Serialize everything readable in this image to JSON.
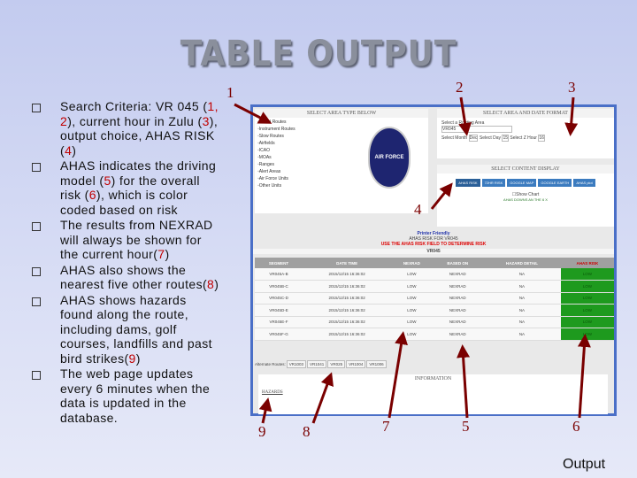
{
  "title": "TABLE OUTPUT",
  "bullets": [
    {
      "parts": [
        "Search Criteria: VR 045 (",
        "1, 2",
        "), current hour in Zulu (",
        "3",
        "), output choice, AHAS RISK (",
        "4",
        ")"
      ]
    },
    {
      "parts": [
        "AHAS indicates the driving model (",
        "5",
        ") for the overall risk (",
        "6",
        "), which is color coded based on risk"
      ]
    },
    {
      "parts": [
        "The results from NEXRAD will always be shown for the current hour(",
        "7",
        ")"
      ]
    },
    {
      "parts": [
        " AHAS also shows the nearest five other routes(",
        "8",
        ")"
      ]
    },
    {
      "parts": [
        "AHAS shows hazards found along the route, including dams, golf courses, landfills and past bird strikes(",
        "9",
        ")"
      ]
    },
    {
      "parts": [
        "The web page updates every 6 minutes when the data is updated in the database."
      ]
    }
  ],
  "screenshot": {
    "area_header": "SELECT AREA TYPE BELOW",
    "area_types": [
      "Visual Routes",
      "Instrument Routes",
      "Slow Routes",
      "Airfields",
      "ICAO",
      "MOAs",
      "Ranges",
      "Alert Areas",
      "Air Force Units",
      "Other Units"
    ],
    "logo_text": [
      "AIR FORCE",
      "SAFETY"
    ],
    "date_header": "SELECT AREA AND DATE FORMAT",
    "select_area_label": "Select a Routing Area",
    "select_area_value": "VR045",
    "month_label": "Select Month",
    "month_value": "Dec",
    "day_label": "Select Day",
    "day_value": "15",
    "hour_label": "Select Z Hour",
    "hour_value": "16",
    "content_header": "SELECT CONTENT DISPLAY",
    "buttons": [
      "AHAS RISK",
      "72HR RISK",
      "GOOGLE MAP",
      "GOOGLE EARTH",
      "AHAS plot"
    ],
    "show_chart": "Show Chart",
    "note": "AHAS DOWNS AN THE 6 X",
    "printer": "Printer Friendly",
    "risk_for": "AHAS RISK FOR VR045",
    "warning": "USE THE AHAS RISK FIELD TO DETERMINE RISK",
    "route": "VR045",
    "columns": [
      "SEGMENT",
      "DATE TIME",
      "NEXRAD",
      "BASED ON",
      "HAZARD DETAIL",
      "AHAS RISK"
    ],
    "rows": [
      [
        "VR045A-B",
        "2015/12/15 16:36:02",
        "LOW",
        "NEXRAD",
        "NA",
        "LOW"
      ],
      [
        "VR045B-C",
        "2015/12/15 16:36:02",
        "LOW",
        "NEXRAD",
        "NA",
        "LOW"
      ],
      [
        "VR045C-D",
        "2015/12/15 16:36:02",
        "LOW",
        "NEXRAD",
        "NA",
        "LOW"
      ],
      [
        "VR045D-E",
        "2015/12/15 16:36:02",
        "LOW",
        "NEXRAD",
        "NA",
        "LOW"
      ],
      [
        "VR045E-F",
        "2015/12/15 16:36:02",
        "LOW",
        "NEXRAD",
        "NA",
        "LOW"
      ],
      [
        "VR045F-G",
        "2015/12/15 16:36:02",
        "LOW",
        "NEXRAD",
        "NA",
        "LOW"
      ]
    ],
    "alt_label": "Alternate Routes:",
    "alt_routes": [
      "VR1003",
      "VR1041",
      "VR025",
      "VR1004",
      "VR1006"
    ],
    "info_header": "INFORMATION",
    "hazards": "HAZARDS"
  },
  "annotations": {
    "n1": "1",
    "n2": "2",
    "n3": "3",
    "n4": "4",
    "n5": "5",
    "n6": "6",
    "n7": "7",
    "n8": "8",
    "n9": "9",
    "output": "Output"
  },
  "colors": {
    "arrow": "#7a0000",
    "risk_low": "#1e9a1e",
    "frame": "#4a6fc7"
  }
}
